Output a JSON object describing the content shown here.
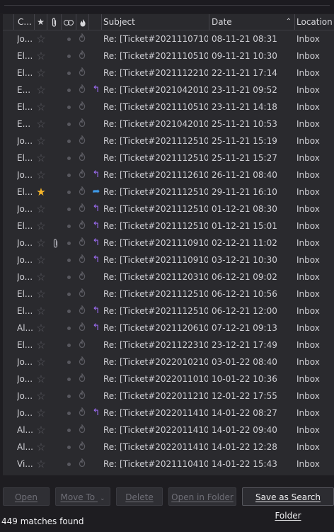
{
  "columns": {
    "correspondents": "C...",
    "subject": "Subject",
    "date": "Date",
    "location": "Location"
  },
  "icons": {
    "star": "star-icon",
    "attachment": "paperclip-icon",
    "read": "read-status-icon",
    "junk": "junk-icon",
    "sort": "sort-ascending-icon"
  },
  "colors": {
    "starred": "#f5b52a",
    "replied": "#9b6bf0",
    "forwarded": "#3f9ae8"
  },
  "messages": [
    {
      "from": "Jo...",
      "starred": false,
      "attachment": false,
      "status": "",
      "subject": "Re: [Ticket#202111071000...",
      "date": "08-11-21 08:31",
      "location": "Inbox"
    },
    {
      "from": "El...",
      "starred": false,
      "attachment": false,
      "status": "",
      "subject": "Re: [Ticket#202111051005...",
      "date": "09-11-21 10:30",
      "location": "Inbox"
    },
    {
      "from": "El...",
      "starred": false,
      "attachment": false,
      "status": "",
      "subject": "Re: [Ticket#202111221000...",
      "date": "22-11-21 17:14",
      "location": "Inbox"
    },
    {
      "from": "E...",
      "starred": false,
      "attachment": false,
      "status": "replied",
      "subject": "Re: [Ticket#202104201002...",
      "date": "23-11-21 09:52",
      "location": "Inbox"
    },
    {
      "from": "El...",
      "starred": false,
      "attachment": false,
      "status": "",
      "subject": "Re: [Ticket#202111051005...",
      "date": "23-11-21 14:18",
      "location": "Inbox"
    },
    {
      "from": "E...",
      "starred": false,
      "attachment": false,
      "status": "",
      "subject": "Re: [Ticket#202104201002...",
      "date": "25-11-21 10:53",
      "location": "Inbox"
    },
    {
      "from": "Jo...",
      "starred": false,
      "attachment": false,
      "status": "",
      "subject": "Re: [Ticket#202111251002...",
      "date": "25-11-21 15:19",
      "location": "Inbox"
    },
    {
      "from": "El...",
      "starred": false,
      "attachment": false,
      "status": "",
      "subject": "Re: [Ticket#202111251002...",
      "date": "25-11-21 15:27",
      "location": "Inbox"
    },
    {
      "from": "Jo...",
      "starred": false,
      "attachment": false,
      "status": "replied",
      "subject": "Re: [Ticket#202111261000...",
      "date": "26-11-21 08:40",
      "location": "Inbox"
    },
    {
      "from": "El...",
      "starred": true,
      "attachment": false,
      "status": "forwarded",
      "subject": "Re: [Ticket#202111251002...",
      "date": "29-11-21 16:10",
      "location": "Inbox"
    },
    {
      "from": "Jo...",
      "starred": false,
      "attachment": false,
      "status": "replied",
      "subject": "Re: [Ticket#202111251002...",
      "date": "01-12-21 08:30",
      "location": "Inbox"
    },
    {
      "from": "El...",
      "starred": false,
      "attachment": false,
      "status": "replied",
      "subject": "Re: [Ticket#202111251002...",
      "date": "01-12-21 15:01",
      "location": "Inbox"
    },
    {
      "from": "Jo...",
      "starred": false,
      "attachment": true,
      "status": "replied",
      "subject": "Re: [Ticket#202111091001...",
      "date": "02-12-21 11:02",
      "location": "Inbox"
    },
    {
      "from": "Jo...",
      "starred": false,
      "attachment": false,
      "status": "replied",
      "subject": "Re: [Ticket#202111091001...",
      "date": "03-12-21 10:30",
      "location": "Inbox"
    },
    {
      "from": "Jo...",
      "starred": false,
      "attachment": false,
      "status": "",
      "subject": "Re: [Ticket#202112031002...",
      "date": "06-12-21 09:02",
      "location": "Inbox"
    },
    {
      "from": "El...",
      "starred": false,
      "attachment": false,
      "status": "",
      "subject": "Re: [Ticket#202111251002...",
      "date": "06-12-21 10:56",
      "location": "Inbox"
    },
    {
      "from": "El...",
      "starred": false,
      "attachment": false,
      "status": "replied",
      "subject": "Re: [Ticket#202111251002...",
      "date": "06-12-21 12:00",
      "location": "Inbox"
    },
    {
      "from": "Al...",
      "starred": false,
      "attachment": false,
      "status": "replied",
      "subject": "Re: [Ticket#202112061000...",
      "date": "07-12-21 09:13",
      "location": "Inbox"
    },
    {
      "from": "El...",
      "starred": false,
      "attachment": false,
      "status": "",
      "subject": "Re: [Ticket#202112231003...",
      "date": "23-12-21 17:49",
      "location": "Inbox"
    },
    {
      "from": "Jo...",
      "starred": false,
      "attachment": false,
      "status": "",
      "subject": "Re: [Ticket#202201021000...",
      "date": "03-01-22 08:40",
      "location": "Inbox"
    },
    {
      "from": "Jo...",
      "starred": false,
      "attachment": false,
      "status": "",
      "subject": "Re: [Ticket#202201101000...",
      "date": "10-01-22 10:36",
      "location": "Inbox"
    },
    {
      "from": "Jo...",
      "starred": false,
      "attachment": false,
      "status": "",
      "subject": "Re: [Ticket#202201121002...",
      "date": "12-01-22 17:55",
      "location": "Inbox"
    },
    {
      "from": "Jo...",
      "starred": false,
      "attachment": false,
      "status": "replied",
      "subject": "Re: [Ticket#202201141001...",
      "date": "14-01-22 08:27",
      "location": "Inbox"
    },
    {
      "from": "Al...",
      "starred": false,
      "attachment": false,
      "status": "",
      "subject": "Re: [Ticket#202201141001...",
      "date": "14-01-22 09:40",
      "location": "Inbox"
    },
    {
      "from": "Al...",
      "starred": false,
      "attachment": false,
      "status": "",
      "subject": "Re: [Ticket#202201141001...",
      "date": "14-01-22 12:28",
      "location": "Inbox"
    },
    {
      "from": "Vi...",
      "starred": false,
      "attachment": false,
      "status": "",
      "subject": "Re: [Ticket#202111041001...",
      "date": "14-01-22 15:43",
      "location": "Inbox"
    }
  ],
  "buttons": {
    "open": "Open",
    "move_to": "Move To",
    "delete": "Delete",
    "open_in_folder": "Open in Folder",
    "save_as_search_folder": "Save as Search Folder"
  },
  "status": {
    "matches": "449 matches found"
  }
}
